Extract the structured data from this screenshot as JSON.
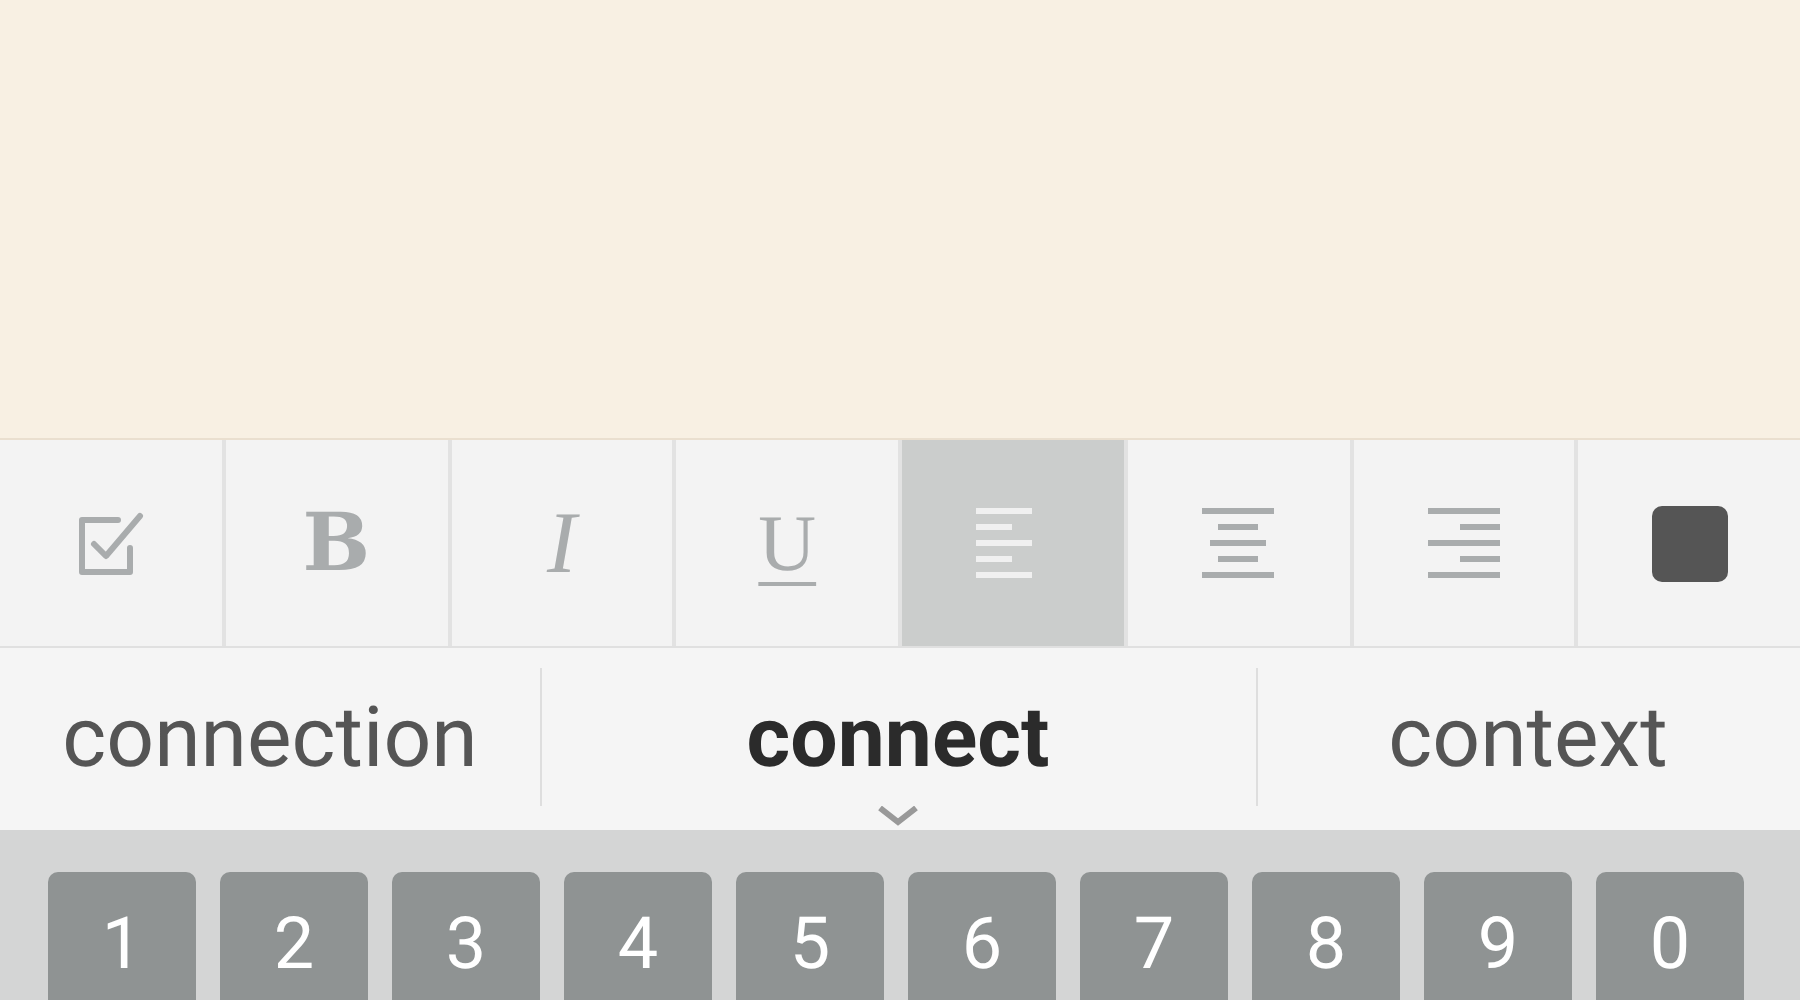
{
  "toolbar": [
    {
      "kind": "checklist",
      "selected": false
    },
    {
      "kind": "bold",
      "label": "B",
      "selected": false
    },
    {
      "kind": "italic",
      "label": "I",
      "selected": false
    },
    {
      "kind": "underline",
      "label": "U",
      "selected": false
    },
    {
      "kind": "align-left",
      "selected": true
    },
    {
      "kind": "align-center",
      "selected": false
    },
    {
      "kind": "align-right",
      "selected": false
    },
    {
      "kind": "color",
      "color": "#555555",
      "selected": false
    }
  ],
  "suggestions": [
    {
      "text": "connection",
      "selected": false
    },
    {
      "text": "connect",
      "selected": true
    },
    {
      "text": "context",
      "selected": false
    }
  ],
  "keyboard": {
    "keys": [
      "1",
      "2",
      "3",
      "4",
      "5",
      "6",
      "7",
      "8",
      "9",
      "0"
    ]
  }
}
